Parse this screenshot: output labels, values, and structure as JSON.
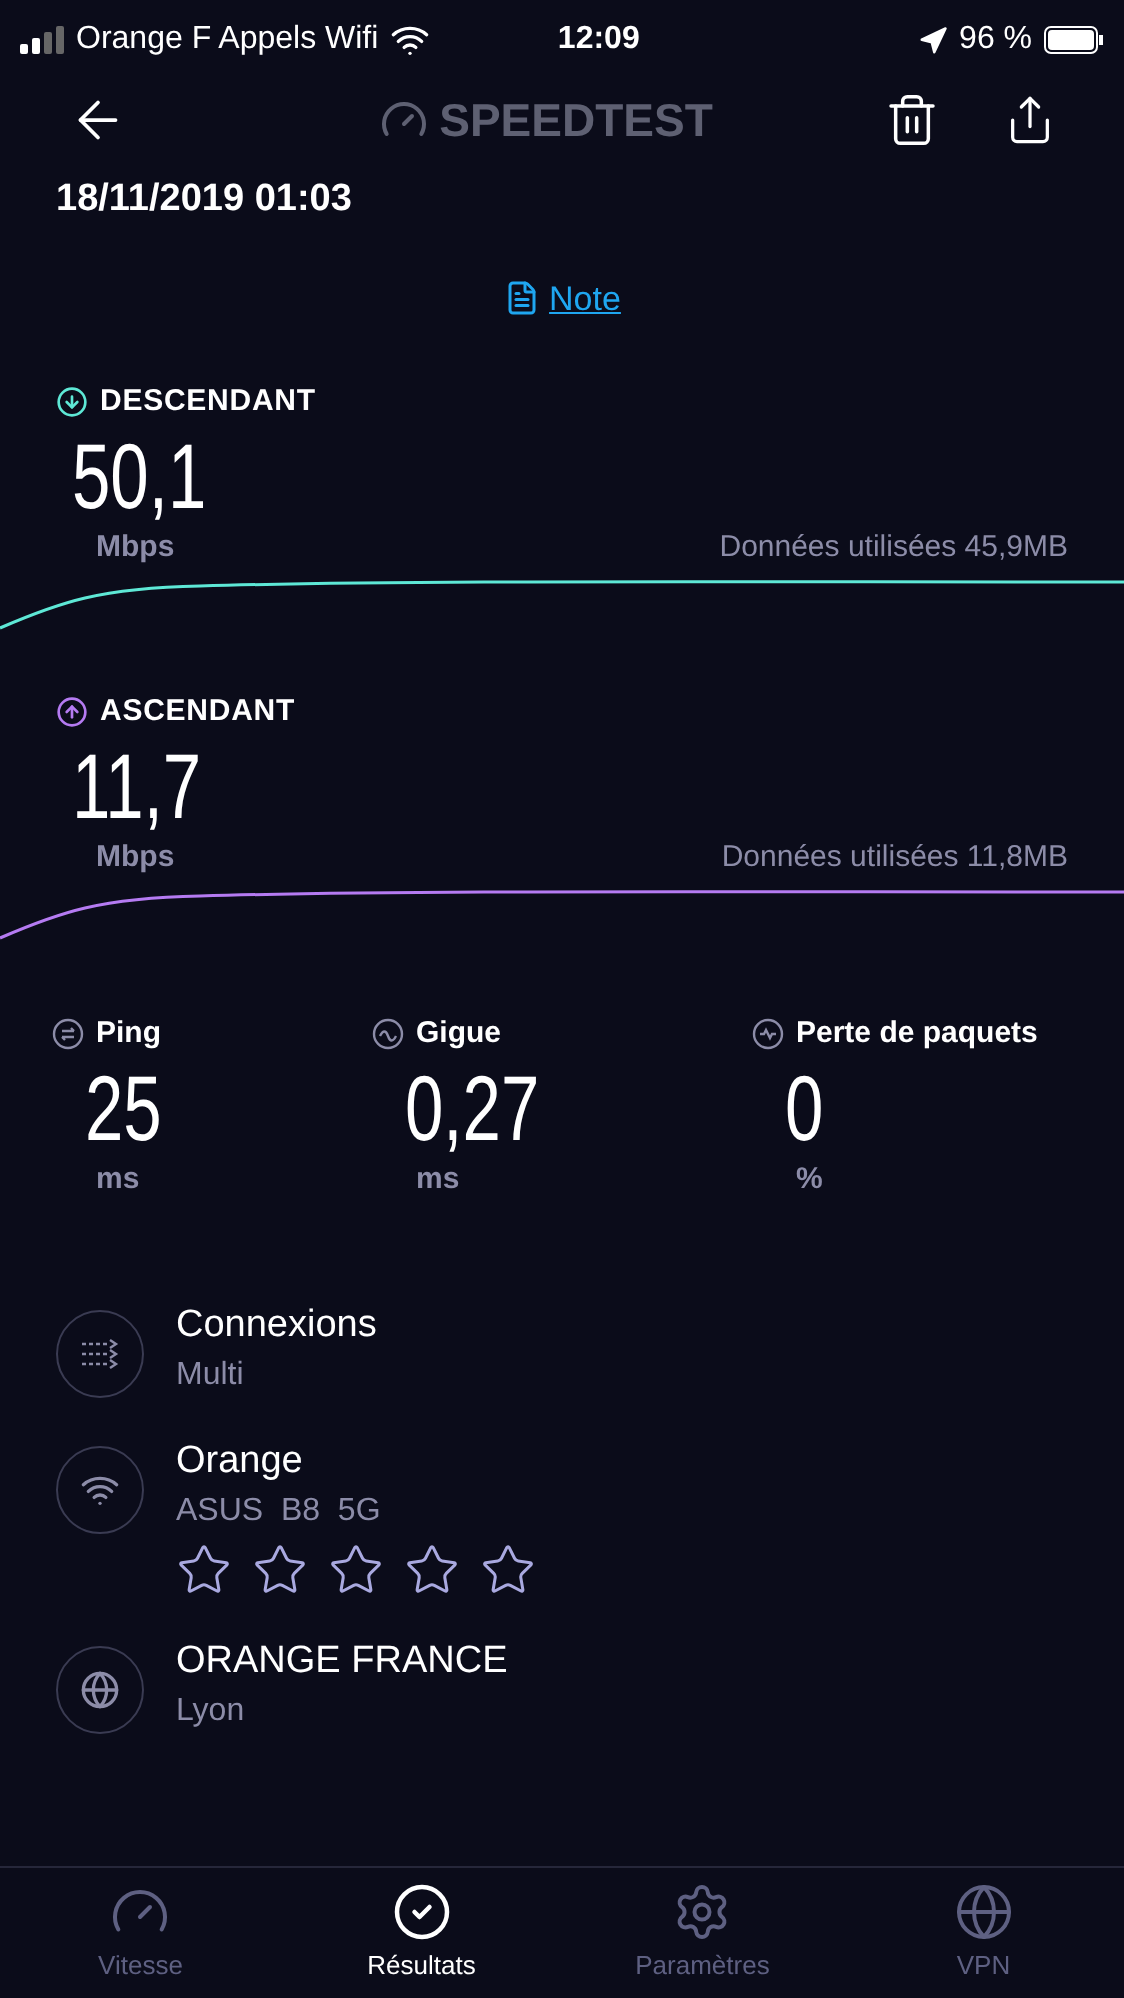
{
  "status_bar": {
    "carrier": "Orange F Appels Wifi",
    "time": "12:09",
    "battery": "96 %"
  },
  "header": {
    "logo": "SPEEDTEST"
  },
  "date": "18/11/2019 01:03",
  "note_link": "Note",
  "speeds": [
    {
      "kind": "download",
      "label": "DESCENDANT",
      "value": "50,1",
      "unit": "Mbps",
      "data_used": "Données utilisées 45,9MB",
      "color": "#5ee8d6"
    },
    {
      "kind": "upload",
      "label": "ASCENDANT",
      "value": "11,7",
      "unit": "Mbps",
      "data_used": "Données utilisées 11,8MB",
      "color": "#b57bf2"
    }
  ],
  "metrics": [
    {
      "kind": "ping",
      "label": "Ping",
      "value": "25",
      "unit": "ms"
    },
    {
      "kind": "jitter",
      "label": "Gigue",
      "value": "0,27",
      "unit": "ms"
    },
    {
      "kind": "loss",
      "label": "Perte de paquets",
      "value": "0",
      "unit": "%"
    }
  ],
  "details": [
    {
      "kind": "connections",
      "title": "Connexions",
      "subtitle": "Multi"
    },
    {
      "kind": "wifi",
      "title": "Orange",
      "subtitle": "ASUS  B8  5G",
      "stars": 0
    },
    {
      "kind": "globe",
      "title": "ORANGE FRANCE",
      "subtitle": "Lyon"
    }
  ],
  "tabs": [
    {
      "kind": "speed",
      "label": "Vitesse",
      "selected": false
    },
    {
      "kind": "results",
      "label": "Résultats",
      "selected": true
    },
    {
      "kind": "settings",
      "label": "Paramètres",
      "selected": false
    },
    {
      "kind": "vpn",
      "label": "VPN",
      "selected": false
    }
  ]
}
